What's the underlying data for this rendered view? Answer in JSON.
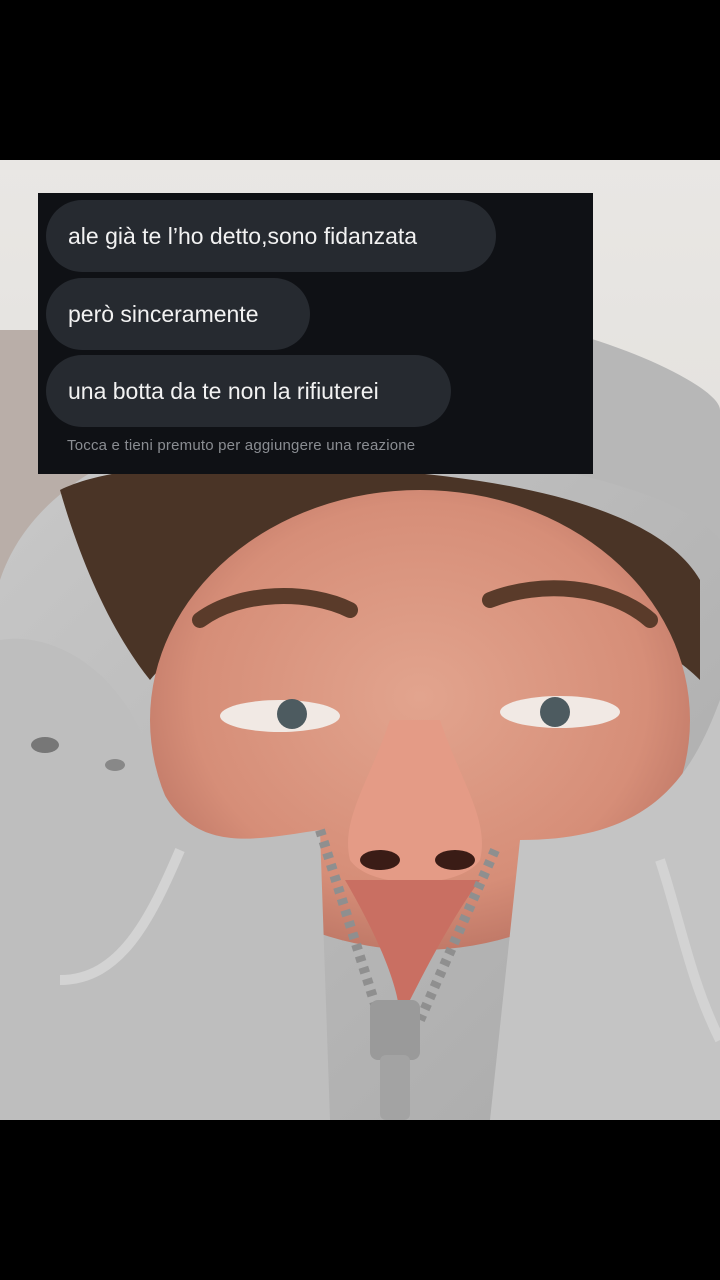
{
  "messages": [
    {
      "text": "ale già te l’ho detto,sono fidanzata"
    },
    {
      "text": "però sinceramente"
    },
    {
      "text": "una botta da te non la rifiuterei"
    }
  ],
  "reaction_hint": "Tocca e tieni premuto per aggiungere una reazione",
  "colors": {
    "background": "#000000",
    "card_background": "#0f1115",
    "bubble": "#262a30",
    "bubble_text": "#f2f2f2",
    "hint_text": "#8a8d92"
  }
}
